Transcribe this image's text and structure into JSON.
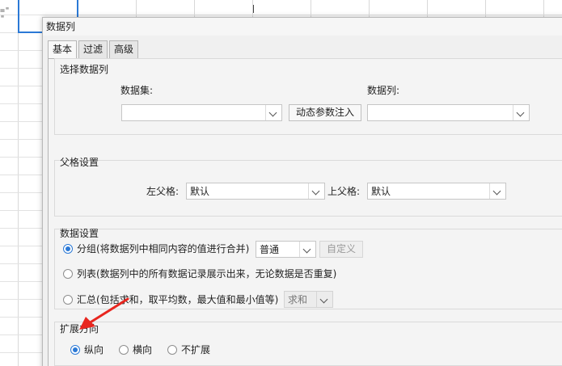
{
  "spreadsheet": {
    "cell_text": "=\"\n\""
  },
  "dialog": {
    "title": "数据列",
    "tabs": [
      "基本",
      "过滤",
      "高级"
    ],
    "select_column": {
      "title": "选择数据列",
      "dataset_label": "数据集:",
      "dataset_value": "",
      "dynamic_param_button": "动态参数注入",
      "column_label": "数据列:",
      "column_value": ""
    },
    "parent_settings": {
      "title": "父格设置",
      "left_parent_label": "左父格:",
      "left_parent_value": "默认",
      "top_parent_label": "上父格:",
      "top_parent_value": "默认"
    },
    "data_settings": {
      "title": "数据设置",
      "group_option": "分组(将数据列中相同内容的值进行合并)",
      "group_mode_value": "普通",
      "custom_button": "自定义",
      "list_option": "列表(数据列中的所有数据记录展示出来，无论数据是否重复)",
      "summary_option": "汇总(包括求和，取平均数，最大值和最小值等)",
      "summary_mode_value": "求和",
      "selected": "group"
    },
    "expand_direction": {
      "title": "扩展方向",
      "options": [
        "纵向",
        "横向",
        "不扩展"
      ],
      "selected": "纵向"
    }
  },
  "colors": {
    "accent": "#2b79d6",
    "annotation_arrow": "#e8261f"
  }
}
